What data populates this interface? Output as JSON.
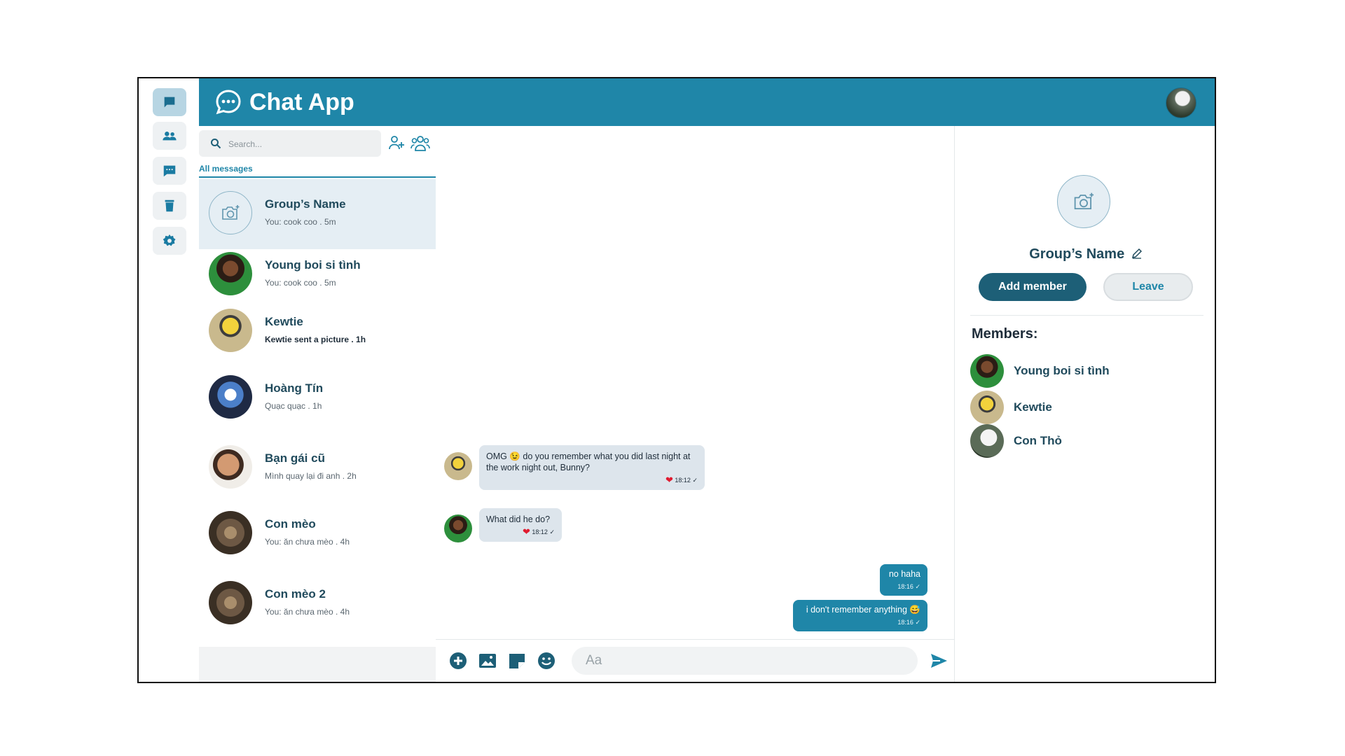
{
  "app": {
    "title": "Chat App"
  },
  "colors": {
    "brand": "#1f86a8",
    "brand_dark": "#1d5f77",
    "selected_row": "#e5eef4",
    "incoming_bubble": "#dde5ec"
  },
  "rail": {
    "items": [
      "chat-icon",
      "users-icon",
      "message-icon",
      "trash-icon",
      "settings-icon"
    ],
    "active_index": 0
  },
  "search": {
    "placeholder": "Search..."
  },
  "tabs": {
    "all_messages": "All messages"
  },
  "conversations": [
    {
      "name": "Group’s Name",
      "preview": "You: cook coo . 5m",
      "selected": true,
      "unread": false
    },
    {
      "name": "Young boi si tình",
      "preview": "You: cook coo . 5m",
      "selected": false,
      "unread": false
    },
    {
      "name": "Kewtie",
      "preview": "Kewtie sent a picture . 1h",
      "selected": false,
      "unread": true
    },
    {
      "name": "Hoàng Tín",
      "preview": "Quạc quạc . 1h",
      "selected": false,
      "unread": false
    },
    {
      "name": "Bạn gái cũ",
      "preview": "Mình quay lại đi anh . 2h",
      "selected": false,
      "unread": false
    },
    {
      "name": "Con mèo",
      "preview": "You: ăn chưa mèo . 4h",
      "selected": false,
      "unread": false
    },
    {
      "name": "Con mèo 2",
      "preview": "You: ăn chưa mèo . 4h",
      "selected": false,
      "unread": false
    }
  ],
  "messages": [
    {
      "direction": "in",
      "text": "OMG 😉 do you remember what you did last night at the work night out, Bunny?",
      "time": "18:12",
      "reaction": "❤",
      "status": "✓"
    },
    {
      "direction": "in",
      "text": "What did he do?",
      "time": "18:12",
      "reaction": "❤",
      "status": "✓"
    },
    {
      "direction": "out",
      "text": "no haha",
      "time": "18:16",
      "status": "✓"
    },
    {
      "direction": "out",
      "text": "i don't remember anything 😅",
      "time": "18:16",
      "status": "✓"
    }
  ],
  "composer": {
    "placeholder": "Aa"
  },
  "group_info": {
    "name": "Group’s Name",
    "add_member_label": "Add member",
    "leave_label": "Leave",
    "members_title": "Members:",
    "members": [
      "Young boi si tình",
      "Kewtie",
      "Con Thỏ"
    ]
  }
}
